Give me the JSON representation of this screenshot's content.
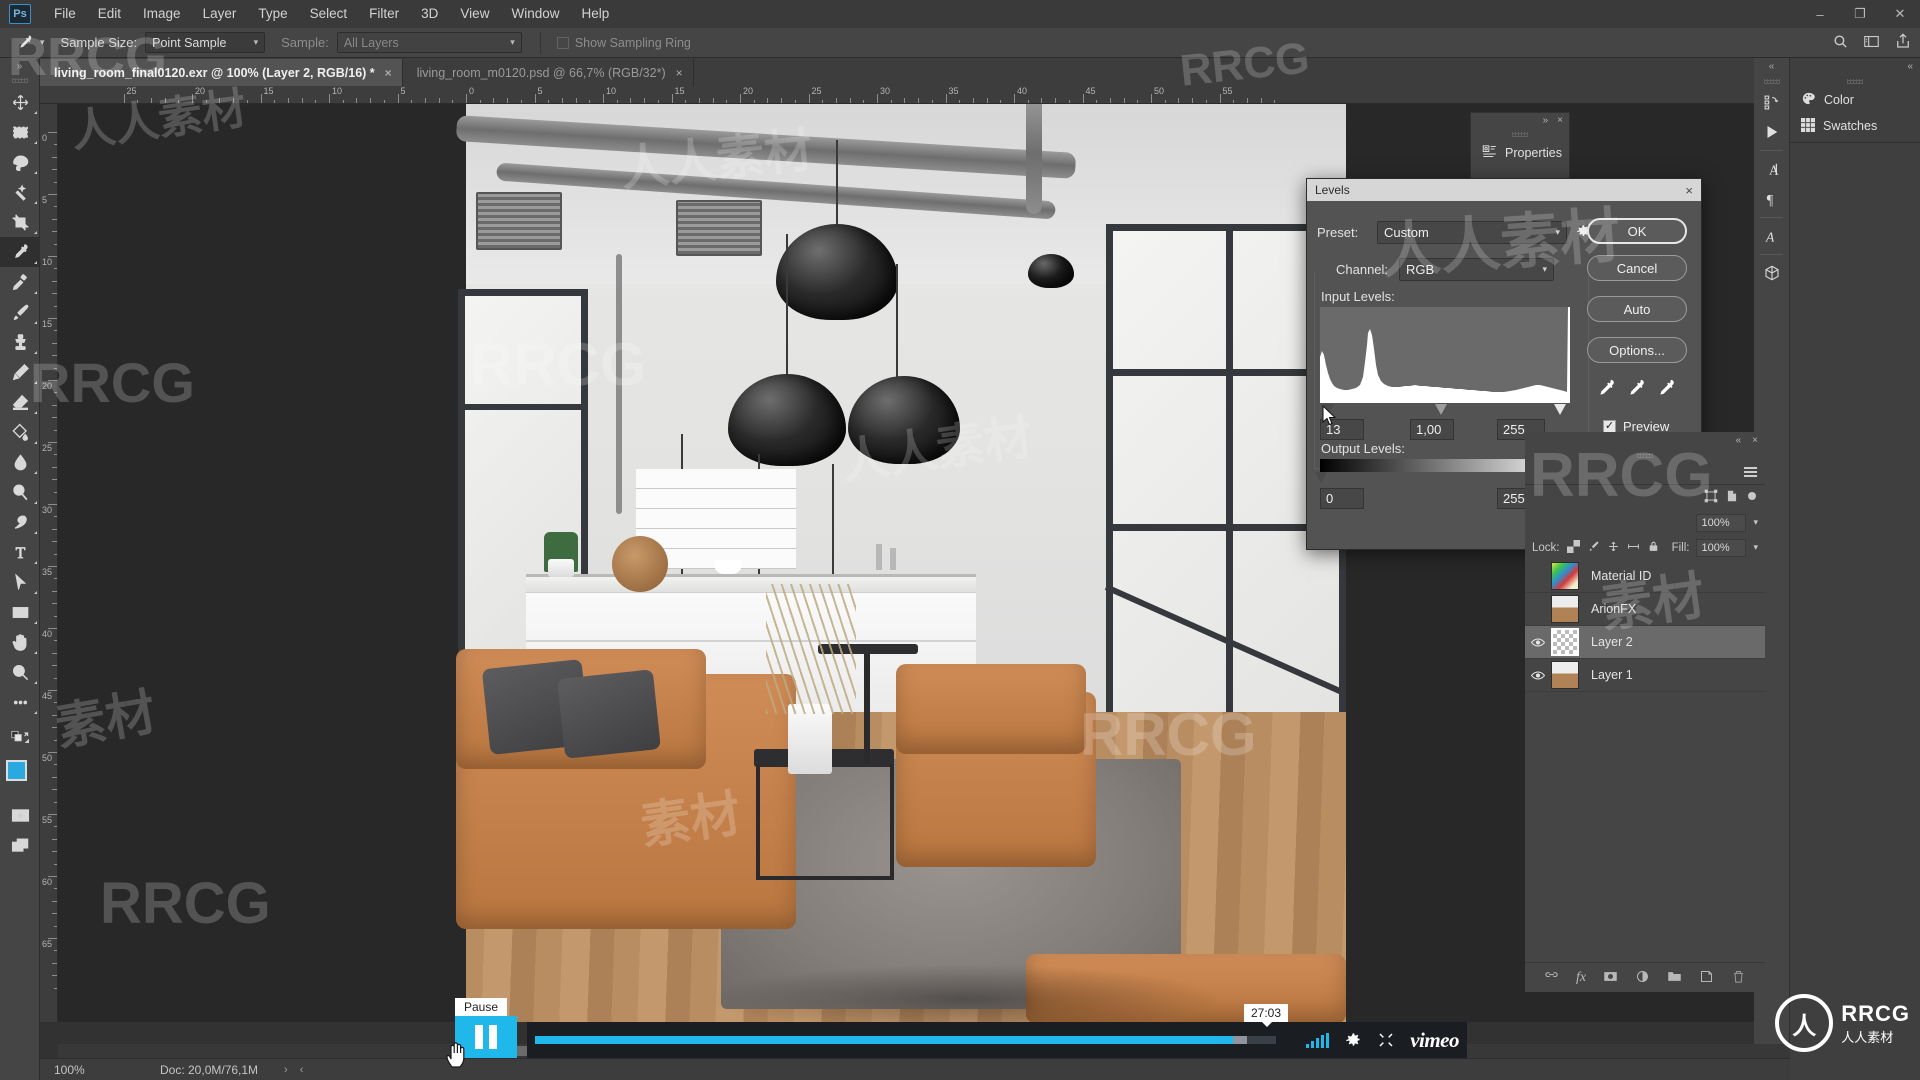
{
  "app": {
    "logo": "Ps",
    "menus": [
      "File",
      "Edit",
      "Image",
      "Layer",
      "Type",
      "Select",
      "Filter",
      "3D",
      "View",
      "Window",
      "Help"
    ],
    "window_controls": [
      "minimize",
      "maximize",
      "close"
    ]
  },
  "options_bar": {
    "tool_icon": "eyedropper-icon",
    "sample_size_label": "Sample Size:",
    "sample_size_value": "Point Sample",
    "sample_label": "Sample:",
    "sample_value": "All Layers",
    "show_sampling_ring_label": "Show Sampling Ring",
    "show_sampling_ring_checked": false,
    "right_icons": [
      "search-icon",
      "workspace-icon",
      "share-icon"
    ]
  },
  "tabs": [
    {
      "label": "living_room_final0120.exr @ 100% (Layer 2, RGB/16) *",
      "active": true,
      "close": "×"
    },
    {
      "label": "living_room_m0120.psd @ 66,7% (RGB/32*)",
      "active": false,
      "close": "×"
    }
  ],
  "toolbar": {
    "collapse": "»",
    "tools": [
      {
        "name": "move-tool",
        "selected": false
      },
      {
        "name": "rectangular-marquee-tool",
        "selected": false
      },
      {
        "name": "lasso-tool",
        "selected": false
      },
      {
        "name": "quick-selection-tool",
        "selected": false
      },
      {
        "name": "crop-tool",
        "selected": false
      },
      {
        "name": "eyedropper-tool",
        "selected": true
      },
      {
        "name": "healing-brush-tool",
        "selected": false
      },
      {
        "name": "brush-tool",
        "selected": false
      },
      {
        "name": "clone-stamp-tool",
        "selected": false
      },
      {
        "name": "history-brush-tool",
        "selected": false
      },
      {
        "name": "eraser-tool",
        "selected": false
      },
      {
        "name": "gradient-tool",
        "selected": false
      },
      {
        "name": "blur-tool",
        "selected": false
      },
      {
        "name": "dodge-tool",
        "selected": false
      },
      {
        "name": "pen-tool",
        "selected": false
      },
      {
        "name": "type-tool",
        "selected": false
      },
      {
        "name": "path-selection-tool",
        "selected": false
      },
      {
        "name": "rectangle-tool",
        "selected": false
      },
      {
        "name": "hand-tool",
        "selected": false
      },
      {
        "name": "zoom-tool",
        "selected": false
      },
      {
        "name": "edit-toolbar-tool",
        "selected": false
      }
    ],
    "foreground_color": "#2aa8e0",
    "background_color": "#ffffff",
    "quick_mask_icon": "quick-mask-icon",
    "screen_mode_icon": "screen-mode-icon"
  },
  "rulers": {
    "unit_hint": "cm",
    "top_ticks": [
      "25",
      "20",
      "15",
      "10",
      "5",
      "0",
      "5",
      "10",
      "15",
      "20",
      "25",
      "30",
      "35",
      "40",
      "45",
      "50",
      "55"
    ],
    "left_ticks": [
      "5",
      "0",
      "5",
      "10",
      "15",
      "20",
      "25",
      "30",
      "35",
      "40",
      "45",
      "50",
      "55",
      "60",
      "65"
    ]
  },
  "levels_dialog": {
    "title": "Levels",
    "close": "×",
    "preset_label": "Preset:",
    "preset_value": "Custom",
    "preset_gear_icon": "gear-icon",
    "channel_label": "Channel:",
    "channel_value": "RGB",
    "input_levels_label": "Input Levels:",
    "input_black": "13",
    "input_gamma": "1,00",
    "input_white": "255",
    "output_levels_label": "Output Levels:",
    "output_black": "0",
    "output_white": "255",
    "buttons": [
      "OK",
      "Cancel",
      "Auto",
      "Options..."
    ],
    "eyedroppers": [
      "set-black-point-icon",
      "set-gray-point-icon",
      "set-white-point-icon"
    ],
    "preview_label": "Preview",
    "preview_checked": true,
    "preview_check_glyph": "✓"
  },
  "right_strip": {
    "collapse": "«",
    "icons": [
      "history-icon",
      "actions-play-icon",
      "character-icon",
      "paragraph-icon",
      "glyphs-icon",
      "3d-icon"
    ]
  },
  "right_dock": {
    "collapse": "«",
    "tabs": [
      {
        "label": "Color",
        "icon": "color-palette-icon"
      },
      {
        "label": "Swatches",
        "icon": "swatches-grid-icon"
      }
    ]
  },
  "properties_panel": {
    "title": "Properties",
    "icon": "properties-icon",
    "expand": "»",
    "close": "×"
  },
  "layers_panel": {
    "collapse": "«",
    "close": "×",
    "menu_icon": "panel-menu-icon",
    "lock_label": "Lock:",
    "fill_label": "Fill:",
    "opacity_value": "100%",
    "fill_value": "100%",
    "layers": [
      {
        "name": "Material ID",
        "visible": false,
        "selected": false,
        "thumb": "matid"
      },
      {
        "name": "ArionFX",
        "visible": false,
        "selected": false,
        "thumb": "photo"
      },
      {
        "name": "Layer 2",
        "visible": true,
        "selected": true,
        "thumb": "transparent"
      },
      {
        "name": "Layer 1",
        "visible": true,
        "selected": false,
        "thumb": "photo"
      }
    ],
    "footer_icons": [
      "link-layers-icon",
      "layer-style-fx-icon",
      "add-layer-mask-icon",
      "adjustment-layer-icon",
      "new-group-icon",
      "new-layer-icon",
      "delete-layer-icon"
    ]
  },
  "status_bar": {
    "zoom": "100%",
    "doc": "Doc: 20,0M/76,1M",
    "arrow_right": "›",
    "arrow_left": "‹"
  },
  "video_player": {
    "provider": "vimeo",
    "play_pause_state": "Pause",
    "tooltip": "Pause",
    "time_tooltip": "27:03",
    "progress_percent": 96,
    "icons": [
      "volume-icon",
      "settings-gear-icon",
      "fullscreen-icon"
    ],
    "brand_color": "#20b7ea"
  },
  "watermarks": {
    "brand": "RRCG",
    "cn": "人人素材",
    "logo_mark": "人"
  },
  "colors": {
    "accent": "#20b7ea",
    "panel_bg": "#454545",
    "canvas_bg": "#282828",
    "dialog_bg": "#535353"
  }
}
